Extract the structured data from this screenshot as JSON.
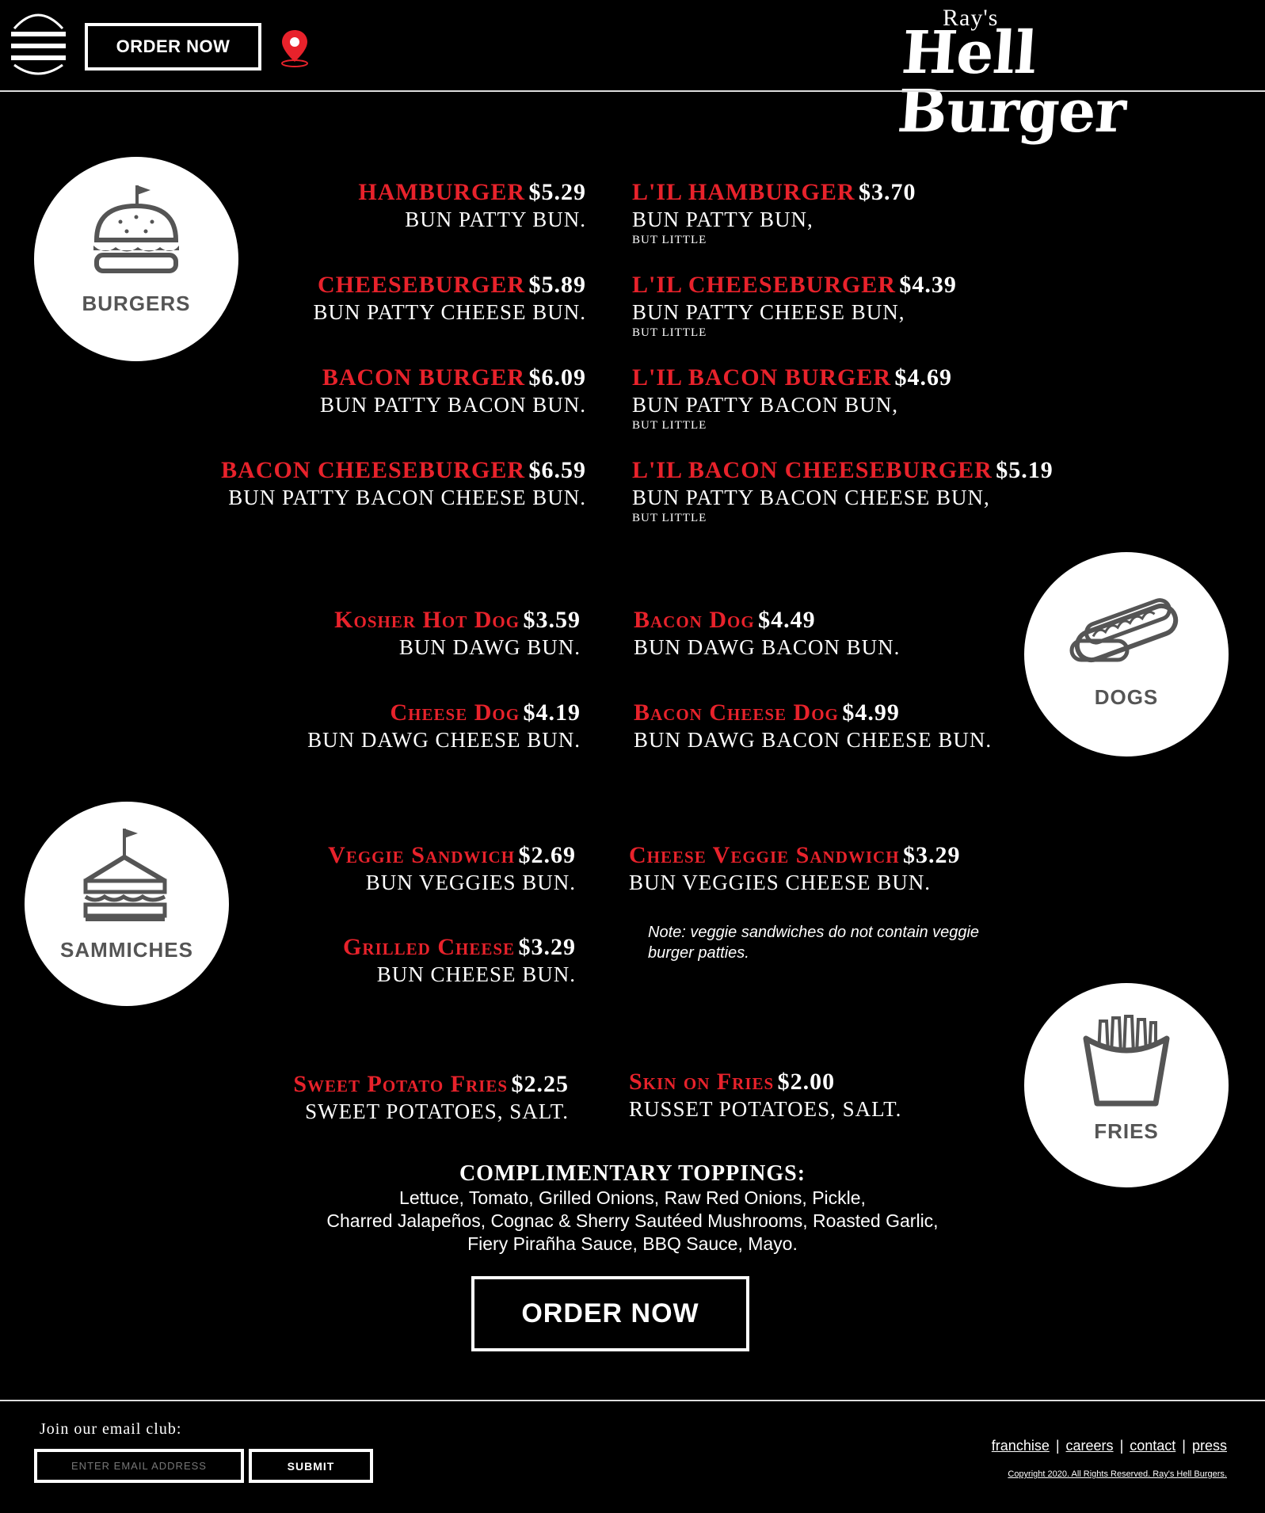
{
  "header": {
    "menu_icon": "hamburger-menu-icon",
    "order_label": "ORDER NOW",
    "location_icon": "map-pin-icon",
    "logo_small": "Ray's",
    "logo_main": "Hell Burger"
  },
  "colors": {
    "accent_red": "#e8222b",
    "background": "#000000",
    "circle_gray": "#555555"
  },
  "categories": {
    "burgers": {
      "label": "BURGERS",
      "icon": "burger-icon"
    },
    "dogs": {
      "label": "DOGS",
      "icon": "hotdog-icon"
    },
    "sammiches": {
      "label": "SAMMICHES",
      "icon": "sandwich-icon"
    },
    "fries": {
      "label": "FRIES",
      "icon": "fries-icon"
    }
  },
  "burgers_left": [
    {
      "name": "HAMBURGER",
      "price": "$5.29",
      "desc": "BUN PATTY BUN."
    },
    {
      "name": "CHEESEBURGER",
      "price": "$5.89",
      "desc": "BUN PATTY CHEESE BUN."
    },
    {
      "name": "BACON BURGER",
      "price": "$6.09",
      "desc": "BUN PATTY BACON BUN."
    },
    {
      "name": "BACON CHEESEBURGER",
      "price": "$6.59",
      "desc": "BUN PATTY BACON CHEESE BUN."
    }
  ],
  "burgers_right": [
    {
      "name": "L'IL HAMBURGER",
      "price": "$3.70",
      "desc": "BUN PATTY BUN,",
      "small": "BUT LITTLE"
    },
    {
      "name": "L'IL CHEESEBURGER",
      "price": "$4.39",
      "desc": "BUN PATTY CHEESE BUN,",
      "small": "BUT LITTLE"
    },
    {
      "name": "L'IL BACON BURGER",
      "price": "$4.69",
      "desc": "BUN PATTY BACON BUN,",
      "small": "BUT LITTLE"
    },
    {
      "name": "L'IL BACON CHEESEBURGER",
      "price": "$5.19",
      "desc": "BUN PATTY BACON CHEESE BUN,",
      "small": "BUT LITTLE"
    }
  ],
  "dogs_left": [
    {
      "name": "Kosher Hot Dog",
      "price": "$3.59",
      "desc": "BUN DAWG BUN."
    },
    {
      "name": "Cheese Dog",
      "price": "$4.19",
      "desc": "BUN DAWG CHEESE BUN."
    }
  ],
  "dogs_right": [
    {
      "name": "Bacon Dog",
      "price": "$4.49",
      "desc": "BUN DAWG BACON BUN."
    },
    {
      "name": "Bacon Cheese Dog",
      "price": "$4.99",
      "desc": "BUN DAWG BACON CHEESE BUN."
    }
  ],
  "sammiches_left": [
    {
      "name": "Veggie Sandwich",
      "price": "$2.69",
      "desc": "BUN VEGGIES BUN."
    },
    {
      "name": "Grilled Cheese",
      "price": "$3.29",
      "desc": "BUN CHEESE BUN."
    }
  ],
  "sammiches_right": [
    {
      "name": "Cheese Veggie Sandwich",
      "price": "$3.29",
      "desc": "BUN VEGGIES CHEESE BUN."
    }
  ],
  "sammiches_note": "Note: veggie sandwiches do not contain veggie burger patties.",
  "fries_left": [
    {
      "name": "Sweet Potato Fries",
      "price": "$2.25",
      "desc": "SWEET POTATOES, SALT."
    }
  ],
  "fries_right": [
    {
      "name": "Skin on Fries",
      "price": "$2.00",
      "desc": "RUSSET POTATOES, SALT."
    }
  ],
  "toppings": {
    "heading": "COMPLIMENTARY TOPPINGS:",
    "lines": [
      "Lettuce, Tomato, Grilled Onions, Raw Red Onions, Pickle,",
      "Charred Jalapeños, Cognac & Sherry Sautéed Mushrooms, Roasted Garlic,",
      "Fiery Pirañha Sauce, BBQ Sauce, Mayo."
    ]
  },
  "order_bottom_label": "ORDER NOW",
  "footer": {
    "email_label": "Join our email club:",
    "email_placeholder": "ENTER EMAIL ADDRESS",
    "email_value": "",
    "submit_label": "SUBMIT",
    "links": [
      "franchise",
      "careers",
      "contact",
      "press"
    ],
    "link_separator": "|",
    "copyright": "Copyright 2020.  All Rights Reserved.  Ray's Hell Burgers."
  }
}
